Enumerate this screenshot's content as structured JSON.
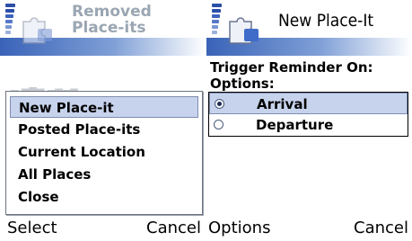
{
  "left_screen": {
    "title_line1": "Removed",
    "title_line2": "Place-its",
    "menu": {
      "items": [
        {
          "label": "New Place-it",
          "selected": true
        },
        {
          "label": "Posted Place-its",
          "selected": false
        },
        {
          "label": "Current Location",
          "selected": false
        },
        {
          "label": "All Places",
          "selected": false
        },
        {
          "label": "Close",
          "selected": false
        }
      ]
    },
    "softkeys": {
      "left": "Select",
      "right": "Cancel"
    }
  },
  "right_screen": {
    "title": "New Place-It",
    "trigger_label": "Trigger Reminder On:",
    "options_label": "Options:",
    "options": [
      {
        "label": "Arrival",
        "checked": true
      },
      {
        "label": "Departure",
        "checked": false
      }
    ],
    "softkeys": {
      "left": "Options",
      "right": "Cancel"
    }
  },
  "colors": {
    "highlight": "#c7d3ec",
    "highlight_border": "#7e8eb0",
    "header_bar": "#5a7fc0"
  }
}
